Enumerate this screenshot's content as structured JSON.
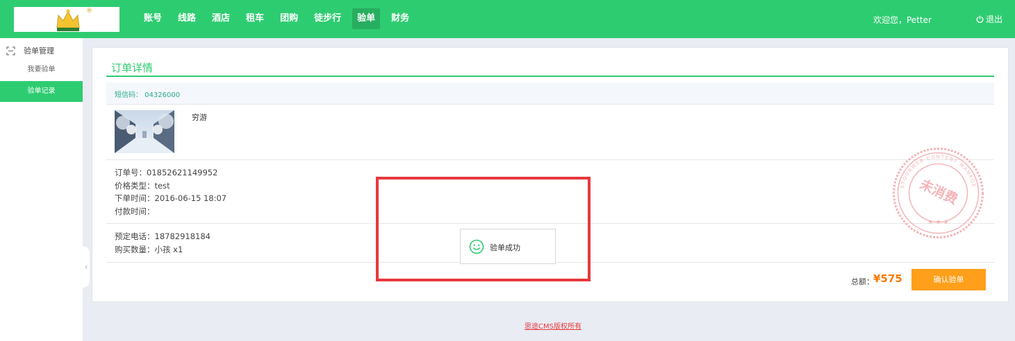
{
  "header": {
    "nav": [
      "账号",
      "线路",
      "酒店",
      "租车",
      "团购",
      "徒步行",
      "验单",
      "财务"
    ],
    "active_nav": "验单",
    "welcome": "欢迎您，Petter",
    "logout_label": "退出"
  },
  "sidebar": {
    "section_label": "验单管理",
    "items": [
      {
        "label": "我要验单",
        "active": false
      },
      {
        "label": "验单记录",
        "active": true
      }
    ]
  },
  "main": {
    "title": "订单详情",
    "sms_code": "短信码： 04326000",
    "product_name": "穷游",
    "order_info": [
      "订单号：01852621149952",
      "价格类型：test",
      "下单时间：2016-06-15 18:07",
      "付款时间："
    ],
    "contact_info": [
      "预定电话：18782918184",
      "购买数量：小孩 x1"
    ],
    "total_label": "总额：",
    "total_value": "¥575",
    "confirm_button": "确认验单",
    "stamp_text": "未消费",
    "stamp_ring_text": "STOURWEB CONTENT MANAGE"
  },
  "toast": {
    "message": "验单成功",
    "icon": "smile-icon"
  },
  "footer": {
    "copyright": "思途CMS版权所有"
  },
  "colors": {
    "brand_green": "#2ecc71",
    "active_green": "#27ae60",
    "orange_button": "#ff9f1a",
    "price_orange": "#ff7a00",
    "highlight_red": "#e8383d",
    "stamp_pink": "#f2a9ad"
  }
}
